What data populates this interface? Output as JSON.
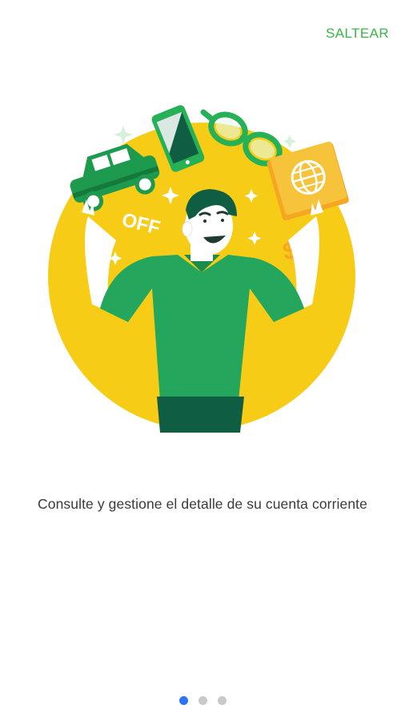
{
  "header": {
    "skip_label": "SALTEAR"
  },
  "illustration": {
    "off_label": "OFF",
    "dollar_label": "$"
  },
  "main": {
    "description": "Consulte y gestione el detalle de su cuenta corriente"
  },
  "pager": {
    "total": 3,
    "active_index": 0
  },
  "colors": {
    "accent": "#3bb54a",
    "yellow": "#f7cc16",
    "shirt_green": "#24a65c",
    "dark_green": "#0f5e44",
    "active_dot": "#2a74f5",
    "inactive_dot": "#c9c9c9"
  }
}
